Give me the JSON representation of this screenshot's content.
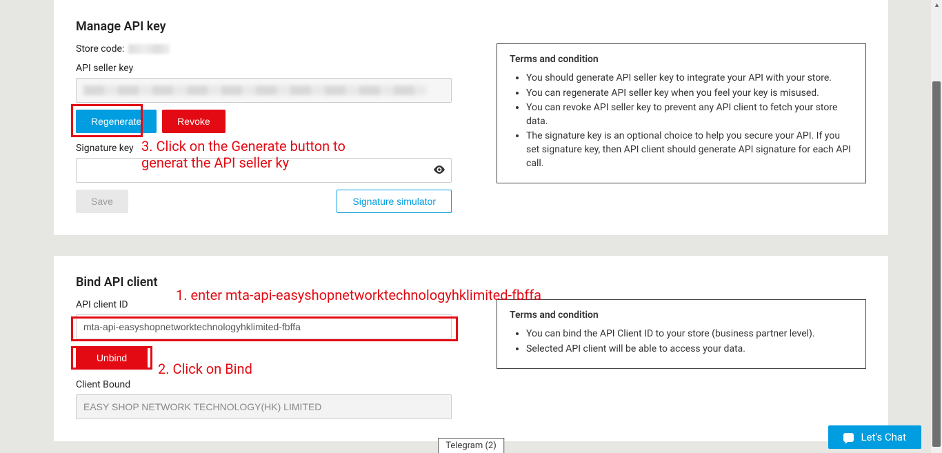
{
  "section1": {
    "title": "Manage API key",
    "store_code_label": "Store code:",
    "api_seller_key_label": "API seller key",
    "regenerate_label": "Regenerate",
    "revoke_label": "Revoke",
    "signature_key_label": "Signature key",
    "save_label": "Save",
    "signature_simulator_label": "Signature simulator",
    "terms_title": "Terms and condition",
    "terms": [
      "You should generate API seller key to integrate your API with your store.",
      "You can regenerate API seller key when you feel your key is misused.",
      "You can revoke API seller key to prevent any API client to fetch your store data.",
      "The signature key is an optional choice to help you secure your API. If you set signature key, then API client should generate API signature for each API call."
    ]
  },
  "section2": {
    "title": "Bind API client",
    "api_client_id_label": "API client ID",
    "api_client_id_value": "mta-api-easyshopnetworktechnologyhklimited-fbffa",
    "unbind_label": "Unbind",
    "client_bound_label": "Client Bound",
    "client_bound_value": "EASY SHOP NETWORK TECHNOLOGY(HK) LIMITED",
    "terms_title": "Terms and condition",
    "terms": [
      "You can bind the API Client ID to your store (business partner level).",
      "Selected API client will be able to access your data."
    ]
  },
  "annotations": {
    "a1": "1. enter mta-api-easyshopnetworktechnologyhklimited-fbffa",
    "a2": "2. Click on Bind",
    "a3a": "3. Click on the Generate button to",
    "a3b": "generat the API seller ky"
  },
  "footer": {
    "telegram_label": "Telegram (2)",
    "chat_label": "Let's Chat"
  }
}
